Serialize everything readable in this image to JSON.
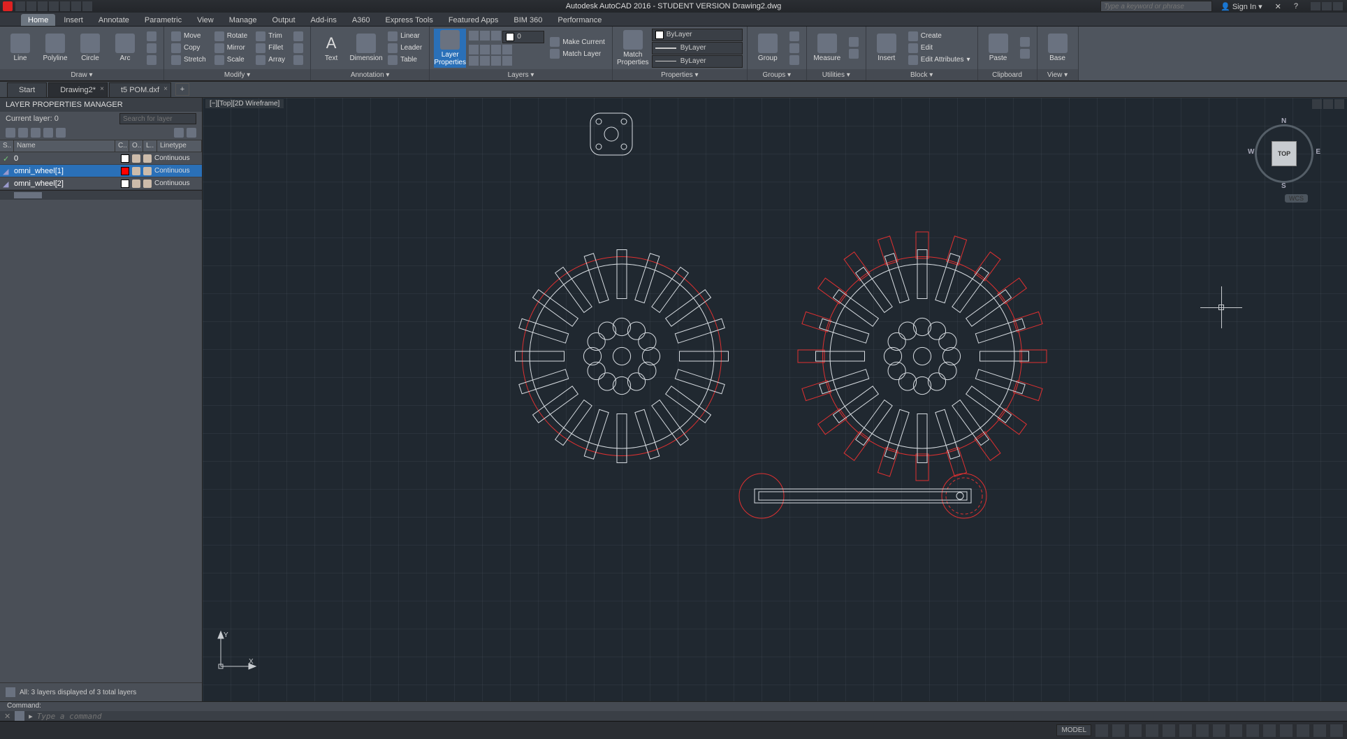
{
  "title": "Autodesk AutoCAD 2016 - STUDENT VERSION    Drawing2.dwg",
  "search_placeholder": "Type a keyword or phrase",
  "sign_in": "Sign In",
  "menu_tabs": [
    "Home",
    "Insert",
    "Annotate",
    "Parametric",
    "View",
    "Manage",
    "Output",
    "Add-ins",
    "A360",
    "Express Tools",
    "Featured Apps",
    "BIM 360",
    "Performance"
  ],
  "active_menu_tab": 0,
  "ribbon": {
    "draw": {
      "title": "Draw ▾",
      "items": [
        "Line",
        "Polyline",
        "Circle",
        "Arc"
      ]
    },
    "modify": {
      "title": "Modify ▾",
      "col1": [
        "Move",
        "Copy",
        "Stretch"
      ],
      "col2": [
        "Rotate",
        "Mirror",
        "Scale"
      ],
      "col3": [
        "Trim",
        "Fillet",
        "Array"
      ]
    },
    "annotation": {
      "title": "Annotation ▾",
      "text": "Text",
      "dimension": "Dimension",
      "items": [
        "Linear",
        "Leader",
        "Table"
      ]
    },
    "layers": {
      "title": "Layers ▾",
      "props": "Layer\nProperties",
      "dd_value": "0",
      "items": [
        "Make Current",
        "Match Layer"
      ]
    },
    "properties": {
      "title": "Properties ▾",
      "match": "Match\nProperties",
      "dd1": "ByLayer",
      "dd2": "ByLayer",
      "dd3": "ByLayer"
    },
    "groups": {
      "title": "Groups ▾",
      "group": "Group"
    },
    "utilities": {
      "title": "Utilities ▾",
      "measure": "Measure"
    },
    "clipboard": {
      "title": "Clipboard",
      "paste": "Paste"
    },
    "block": {
      "title": "Block ▾",
      "insert": "Insert",
      "items": [
        "Create",
        "Edit",
        "Edit Attributes"
      ]
    },
    "view": {
      "title": "View ▾",
      "base": "Base"
    }
  },
  "doc_tabs": [
    {
      "label": "Start",
      "closable": false
    },
    {
      "label": "Drawing2*",
      "closable": true,
      "active": true
    },
    {
      "label": "t5 POM.dxf",
      "closable": true
    }
  ],
  "layer_panel": {
    "title": "LAYER PROPERTIES MANAGER",
    "current": "Current layer: 0",
    "search_placeholder": "Search for layer",
    "headers": {
      "status": "S..",
      "name": "Name",
      "color": "C..",
      "on": "O..",
      "lock": "L..",
      "linetype": "Linetype"
    },
    "rows": [
      {
        "name": "0",
        "color": "#ffffff",
        "linetype": "Continuous",
        "current": true
      },
      {
        "name": "omni_wheel[1]",
        "color": "#ff0000",
        "linetype": "Continuous",
        "selected": true
      },
      {
        "name": "omni_wheel[2]",
        "color": "#ffffff",
        "linetype": "Continuous"
      }
    ],
    "footer": "All: 3 layers displayed of 3 total layers"
  },
  "viewport_label": "[−][Top][2D Wireframe]",
  "viewcube": {
    "face": "TOP",
    "n": "N",
    "s": "S",
    "e": "E",
    "w": "W"
  },
  "wcs": "WCS",
  "ucs": {
    "x": "X",
    "y": "Y"
  },
  "command": {
    "history": "Command:",
    "placeholder": "Type a command"
  },
  "status": {
    "model": "MODEL"
  }
}
